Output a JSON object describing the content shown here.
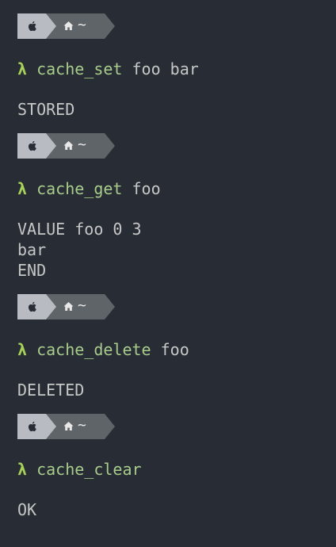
{
  "prompt": {
    "apple_icon": "apple-icon",
    "home_icon": "home-icon",
    "cwd": "~"
  },
  "lambda": "λ",
  "entries": [
    {
      "command": "cache_set",
      "args": "foo bar",
      "output": [
        "STORED"
      ]
    },
    {
      "command": "cache_get",
      "args": "foo",
      "output": [
        "VALUE foo 0 3",
        "bar",
        "END"
      ]
    },
    {
      "command": "cache_delete",
      "args": "foo",
      "output": [
        "DELETED"
      ]
    },
    {
      "command": "cache_clear",
      "args": "",
      "output": [
        "OK"
      ]
    }
  ],
  "colors": {
    "background": "#282c34",
    "lambda": "#a8d15a",
    "command": "#a8cc8c",
    "text": "#c5c8c6",
    "segment_apple": "#b8bcc2",
    "segment_home": "#5f6468"
  }
}
